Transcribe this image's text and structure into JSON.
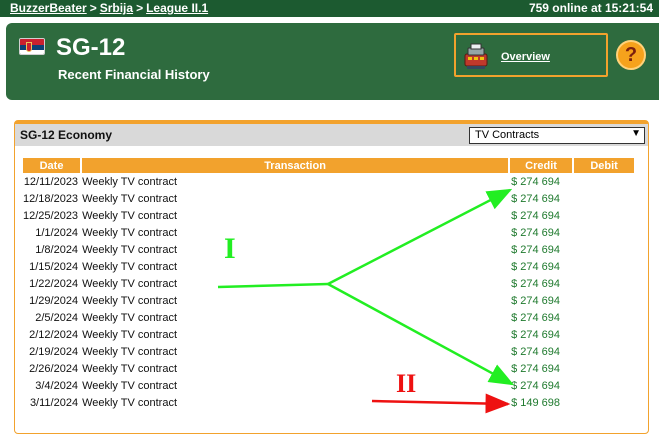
{
  "topbar": {
    "breadcrumb": [
      "BuzzerBeater",
      "Srbija",
      "League II.1"
    ],
    "separator": ">",
    "online_status": "759 online at 15:21:54"
  },
  "header": {
    "team_name": "SG-12",
    "subtitle": "Recent Financial History",
    "flag_icon": "serbia-flag-icon",
    "overview_label": "Overview",
    "help_label": "?"
  },
  "economy": {
    "title": "SG-12 Economy",
    "filter_selected": "TV Contracts",
    "columns": [
      "Date",
      "Transaction",
      "Credit",
      "Debit"
    ],
    "rows": [
      {
        "date": "12/11/2023",
        "transaction": "Weekly TV contract",
        "credit": "$ 274 694",
        "debit": ""
      },
      {
        "date": "12/18/2023",
        "transaction": "Weekly TV contract",
        "credit": "$ 274 694",
        "debit": ""
      },
      {
        "date": "12/25/2023",
        "transaction": "Weekly TV contract",
        "credit": "$ 274 694",
        "debit": ""
      },
      {
        "date": "1/1/2024",
        "transaction": "Weekly TV contract",
        "credit": "$ 274 694",
        "debit": ""
      },
      {
        "date": "1/8/2024",
        "transaction": "Weekly TV contract",
        "credit": "$ 274 694",
        "debit": ""
      },
      {
        "date": "1/15/2024",
        "transaction": "Weekly TV contract",
        "credit": "$ 274 694",
        "debit": ""
      },
      {
        "date": "1/22/2024",
        "transaction": "Weekly TV contract",
        "credit": "$ 274 694",
        "debit": ""
      },
      {
        "date": "1/29/2024",
        "transaction": "Weekly TV contract",
        "credit": "$ 274 694",
        "debit": ""
      },
      {
        "date": "2/5/2024",
        "transaction": "Weekly TV contract",
        "credit": "$ 274 694",
        "debit": ""
      },
      {
        "date": "2/12/2024",
        "transaction": "Weekly TV contract",
        "credit": "$ 274 694",
        "debit": ""
      },
      {
        "date": "2/19/2024",
        "transaction": "Weekly TV contract",
        "credit": "$ 274 694",
        "debit": ""
      },
      {
        "date": "2/26/2024",
        "transaction": "Weekly TV contract",
        "credit": "$ 274 694",
        "debit": ""
      },
      {
        "date": "3/4/2024",
        "transaction": "Weekly TV contract",
        "credit": "$ 274 694",
        "debit": ""
      },
      {
        "date": "3/11/2024",
        "transaction": "Weekly TV contract",
        "credit": "$ 149 698",
        "debit": ""
      }
    ]
  },
  "annotations": {
    "label_one": "I",
    "label_two": "II",
    "color_green": "#22ee22",
    "color_red": "#ee1111"
  },
  "colors": {
    "topbar": "#1c5a30",
    "header": "#2e6b3e",
    "accent_orange": "#f2a22d",
    "credit_green": "#1f7a2e"
  }
}
